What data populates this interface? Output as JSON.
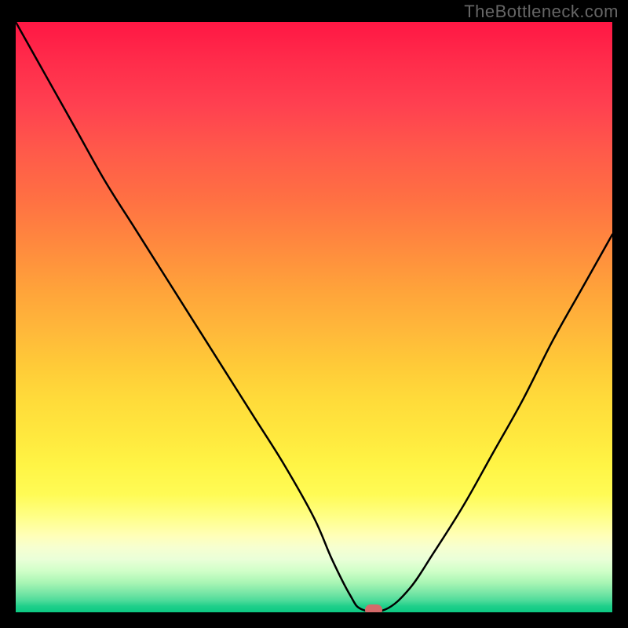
{
  "watermark": "TheBottleneck.com",
  "chart_data": {
    "type": "line",
    "title": "",
    "xlabel": "",
    "ylabel": "",
    "xlim": [
      0,
      100
    ],
    "ylim": [
      0,
      100
    ],
    "series": [
      {
        "name": "bottleneck-curve",
        "x": [
          0,
          5,
          10,
          15,
          20,
          25,
          30,
          35,
          40,
          45,
          50,
          53,
          56,
          58,
          62,
          66,
          70,
          75,
          80,
          85,
          90,
          95,
          100
        ],
        "values": [
          100,
          91,
          82,
          73,
          65,
          57,
          49,
          41,
          33,
          25,
          16,
          9,
          3,
          0.5,
          0.5,
          4,
          10,
          18,
          27,
          36,
          46,
          55,
          64
        ]
      }
    ],
    "minimum_point": {
      "x": 60,
      "y": 0
    },
    "gradient_bands": [
      {
        "pos": 0,
        "meaning": "worst",
        "color": "#ff1744"
      },
      {
        "pos": 50,
        "meaning": "mid",
        "color": "#ffca38"
      },
      {
        "pos": 90,
        "meaning": "good",
        "color": "#ffffb8"
      },
      {
        "pos": 100,
        "meaning": "best",
        "color": "#0cc983"
      }
    ]
  }
}
